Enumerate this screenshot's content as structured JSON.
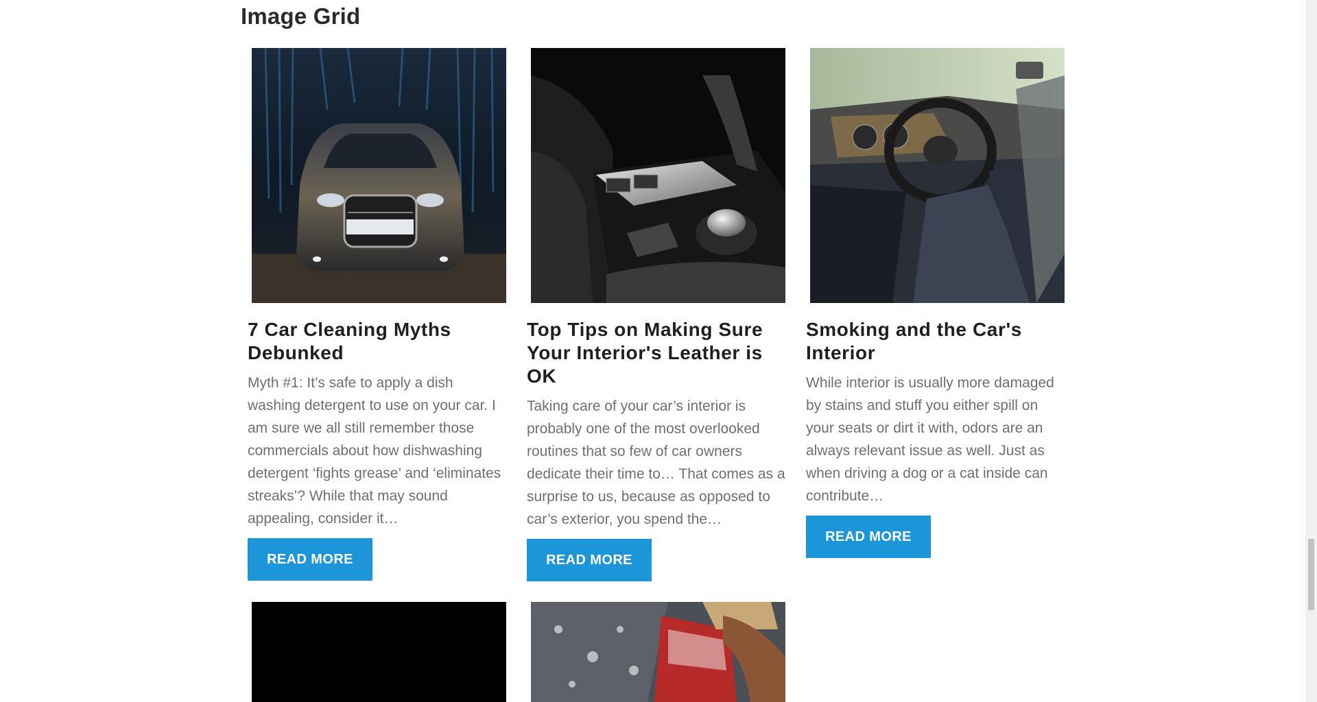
{
  "section": {
    "title": "Image Grid"
  },
  "cards": [
    {
      "image_alt": "Car inside automatic car wash",
      "title": "7 Car Cleaning Myths Debunked",
      "excerpt": "Myth #1: It’s safe to apply a dish washing detergent to use on your car. I am sure we all still remember those commercials about how dishwashing detergent ‘fights grease’ and ‘eliminates streaks’? While that may sound appealing, consider it…",
      "button_label": "READ MORE"
    },
    {
      "image_alt": "Car center console and gear shifter",
      "title": "Top Tips on Making Sure Your Interior's Leather is OK",
      "excerpt": "Taking care of your car’s interior is probably one of the most overlooked routines that so few of car owners dedicate their time to… That comes as a surprise to us, because as opposed to car’s exterior, you spend the…",
      "button_label": "READ MORE"
    },
    {
      "image_alt": "Car interior with steering wheel and seats",
      "title": "Smoking and the Car's Interior",
      "excerpt": "While interior is usually more damaged by stains and stuff you either spill on your seats or dirt it with, odors are an always relevant issue as well. Just as when driving a dog or a cat inside can contribute…",
      "button_label": "READ MORE"
    }
  ],
  "colors": {
    "button": "#1d96d9",
    "title_text": "#1f1f1f",
    "excerpt_text": "#6f6f6f"
  }
}
